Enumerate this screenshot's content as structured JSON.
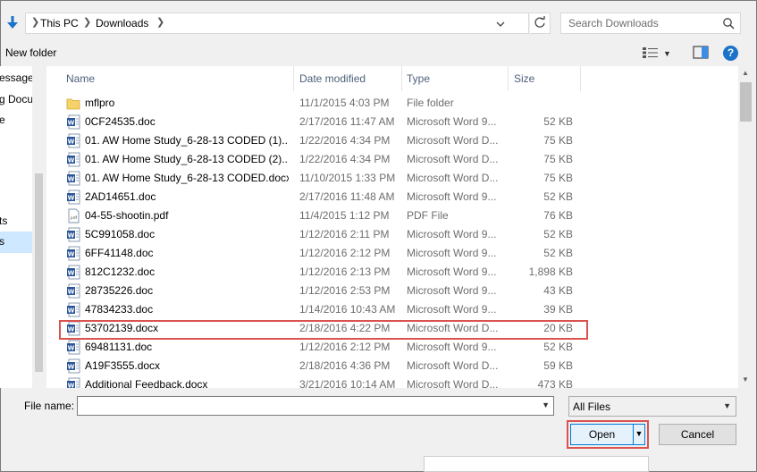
{
  "address": {
    "crumbs": [
      "This PC",
      "Downloads"
    ],
    "search_placeholder": "Search Downloads"
  },
  "toolbar": {
    "new_folder": "New folder",
    "help": "?"
  },
  "nav": {
    "items": [
      "essage",
      "g Docu",
      "e",
      "ts",
      "s"
    ]
  },
  "columns": {
    "name": "Name",
    "date": "Date modified",
    "type": "Type",
    "size": "Size"
  },
  "files": [
    {
      "name": "mflpro",
      "date": "11/1/2015 4:03 PM",
      "type": "File folder",
      "size": "",
      "icon": "folder-icon"
    },
    {
      "name": "0CF24535.doc",
      "date": "2/17/2016 11:47 AM",
      "type": "Microsoft Word 9...",
      "size": "52 KB",
      "icon": "word-icon"
    },
    {
      "name": "01.   AW Home Study_6-28-13 CODED (1)...",
      "date": "1/22/2016 4:34 PM",
      "type": "Microsoft Word D...",
      "size": "75 KB",
      "icon": "word-icon"
    },
    {
      "name": "01.   AW Home Study_6-28-13 CODED (2)...",
      "date": "1/22/2016 4:34 PM",
      "type": "Microsoft Word D...",
      "size": "75 KB",
      "icon": "word-icon"
    },
    {
      "name": "01.   AW Home Study_6-28-13 CODED.docx",
      "date": "11/10/2015 1:33 PM",
      "type": "Microsoft Word D...",
      "size": "75 KB",
      "icon": "word-icon"
    },
    {
      "name": "2AD14651.doc",
      "date": "2/17/2016 11:48 AM",
      "type": "Microsoft Word 9...",
      "size": "52 KB",
      "icon": "word-icon"
    },
    {
      "name": "04-55-shootin.pdf",
      "date": "11/4/2015 1:12 PM",
      "type": "PDF File",
      "size": "76 KB",
      "icon": "pdf-icon"
    },
    {
      "name": "5C991058.doc",
      "date": "1/12/2016 2:11 PM",
      "type": "Microsoft Word 9...",
      "size": "52 KB",
      "icon": "word-icon"
    },
    {
      "name": "6FF41148.doc",
      "date": "1/12/2016 2:12 PM",
      "type": "Microsoft Word 9...",
      "size": "52 KB",
      "icon": "word-icon"
    },
    {
      "name": "812C1232.doc",
      "date": "1/12/2016 2:13 PM",
      "type": "Microsoft Word 9...",
      "size": "1,898 KB",
      "icon": "word-icon"
    },
    {
      "name": "28735226.doc",
      "date": "1/12/2016 2:53 PM",
      "type": "Microsoft Word 9...",
      "size": "43 KB",
      "icon": "word-icon"
    },
    {
      "name": "47834233.doc",
      "date": "1/14/2016 10:43 AM",
      "type": "Microsoft Word 9...",
      "size": "39 KB",
      "icon": "word-icon"
    },
    {
      "name": "53702139.docx",
      "date": "2/18/2016 4:22 PM",
      "type": "Microsoft Word D...",
      "size": "20 KB",
      "icon": "word-icon"
    },
    {
      "name": "69481131.doc",
      "date": "1/12/2016 2:12 PM",
      "type": "Microsoft Word 9...",
      "size": "52 KB",
      "icon": "word-icon"
    },
    {
      "name": "A19F3555.docx",
      "date": "2/18/2016 4:36 PM",
      "type": "Microsoft Word D...",
      "size": "59 KB",
      "icon": "word-icon"
    },
    {
      "name": "Additional Feedback.docx",
      "date": "3/21/2016 10:14 AM",
      "type": "Microsoft Word D...",
      "size": "473 KB",
      "icon": "word-icon"
    }
  ],
  "footer": {
    "file_name_label": "File name:",
    "file_name_value": "",
    "file_type": "All Files",
    "open": "Open",
    "cancel": "Cancel"
  },
  "colors": {
    "highlight": "#d9534f",
    "accent": "#0078d7",
    "selection": "#cde8ff"
  }
}
